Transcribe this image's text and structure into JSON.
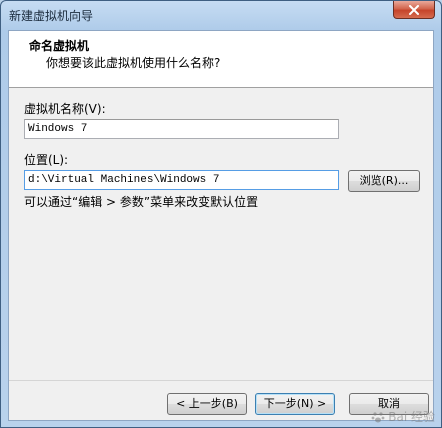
{
  "window": {
    "title": "新建虚拟机向导",
    "close_glyph": "✕"
  },
  "header": {
    "title": "命名虚拟机",
    "subtitle": "你想要该此虚拟机使用什么名称?"
  },
  "form": {
    "name_label": "虚拟机名称(V):",
    "name_value": "Windows 7",
    "location_label": "位置(L):",
    "location_value": "d:\\Virtual Machines\\Windows 7",
    "browse_label": "浏览(R)...",
    "hint": "可以通过“编辑 > 参数”菜单来改变默认位置"
  },
  "footer": {
    "back_label": "< 上一步(B)",
    "next_label": "下一步(N) >",
    "cancel_label": "取消"
  },
  "watermark": {
    "text": "Bai 经验",
    "icon": "paw-icon"
  },
  "colors": {
    "titlebar": "#b9d2ec",
    "close_button": "#c5442b",
    "default_button_border": "#3c7fb1"
  }
}
